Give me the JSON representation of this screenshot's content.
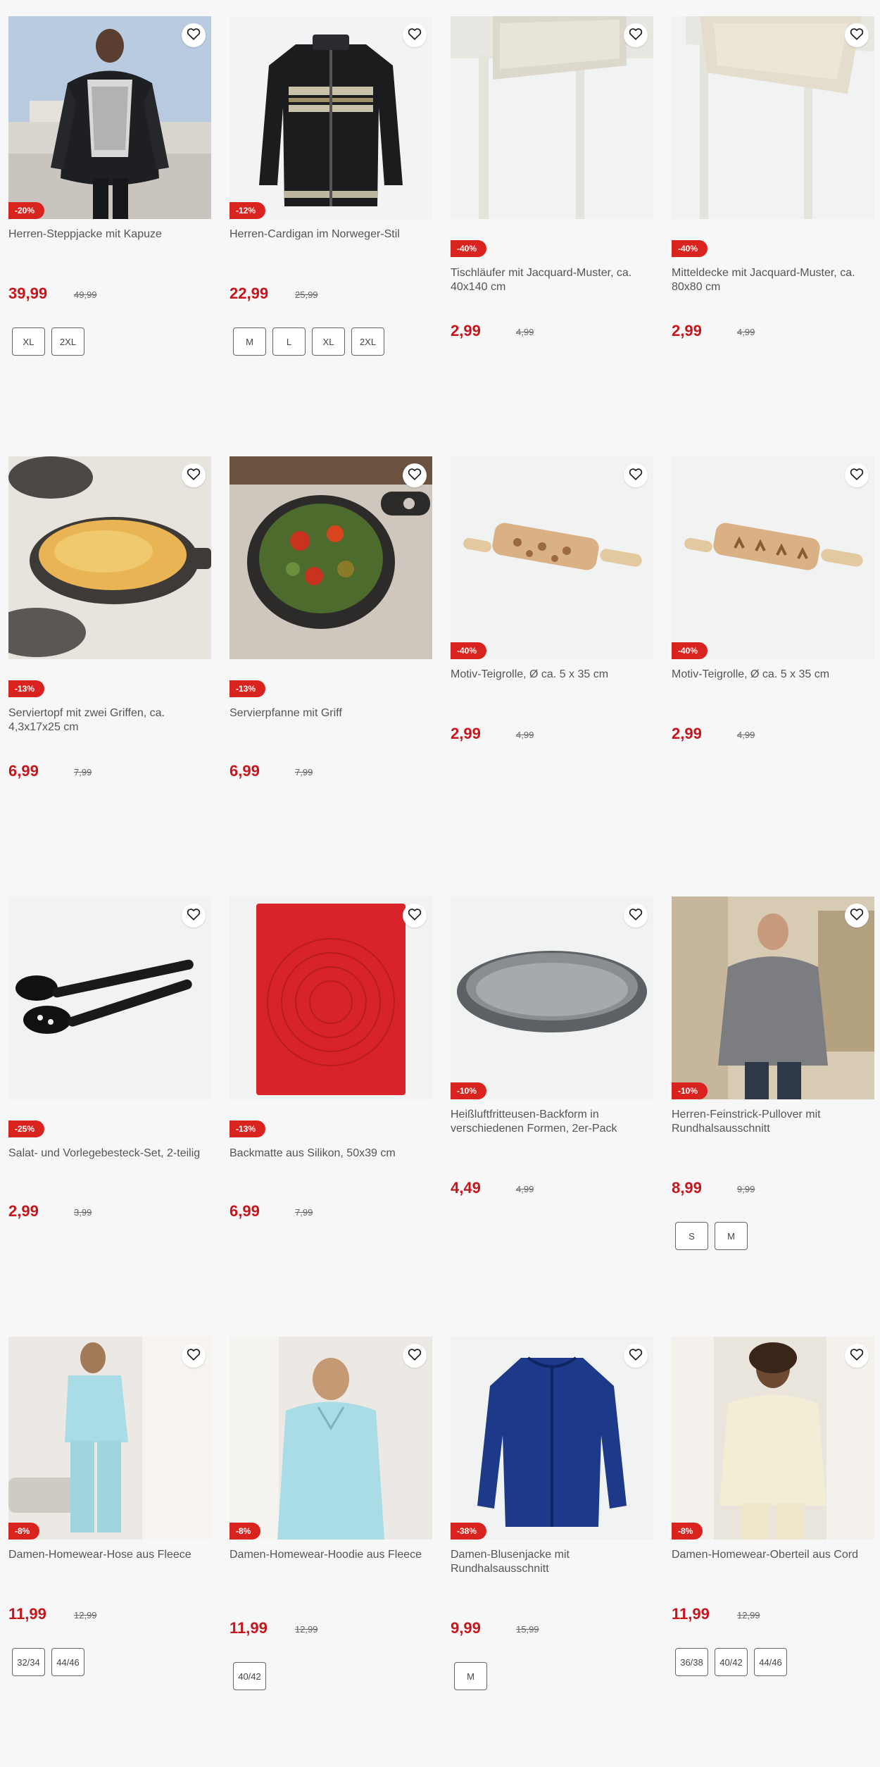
{
  "products": [
    {
      "title": "Herren-Steppjacke mit Kapuze",
      "badge": "-20%",
      "price": "39,99",
      "old_price": "49,99",
      "sizes": [
        "XL",
        "2XL"
      ],
      "image": "puffer-jacket"
    },
    {
      "title": "Herren-Cardigan im Norweger-Stil",
      "badge": "-12%",
      "price": "22,99",
      "old_price": "25,99",
      "sizes": [
        "M",
        "L",
        "XL",
        "2XL"
      ],
      "image": "cardigan"
    },
    {
      "title": "Tischläufer mit Jacquard-Muster, ca. 40x140 cm",
      "badge": "-40%",
      "price": "2,99",
      "old_price": "4,99",
      "sizes": [],
      "image": "table-runner"
    },
    {
      "title": "Mitteldecke mit Jacquard-Muster, ca. 80x80 cm",
      "badge": "-40%",
      "price": "2,99",
      "old_price": "4,99",
      "sizes": [],
      "image": "table-cloth"
    },
    {
      "title": "Serviertopf mit zwei Griffen, ca. 4,3x17x25 cm",
      "badge": "-13%",
      "price": "6,99",
      "old_price": "7,99",
      "sizes": [],
      "image": "serving-pot"
    },
    {
      "title": "Servierpfanne mit Griff",
      "badge": "-13%",
      "price": "6,99",
      "old_price": "7,99",
      "sizes": [],
      "image": "serving-pan"
    },
    {
      "title": "Motiv-Teigrolle, Ø ca. 5 x 35 cm",
      "badge": "-40%",
      "price": "2,99",
      "old_price": "4,99",
      "sizes": [],
      "image": "rolling-pin-stars"
    },
    {
      "title": "Motiv-Teigrolle, Ø ca. 5 x 35 cm",
      "badge": "-40%",
      "price": "2,99",
      "old_price": "4,99",
      "sizes": [],
      "image": "rolling-pin-reindeer"
    },
    {
      "title": "Salat- und Vorlegebesteck-Set, 2-teilig",
      "badge": "-25%",
      "price": "2,99",
      "old_price": "3,99",
      "sizes": [],
      "image": "salad-servers"
    },
    {
      "title": "Backmatte aus Silikon, 50x39 cm",
      "badge": "-13%",
      "price": "6,99",
      "old_price": "7,99",
      "sizes": [],
      "image": "baking-mat"
    },
    {
      "title": "Heißluftfritteusen-Backform in verschiedenen Formen, 2er-Pack",
      "badge": "-10%",
      "price": "4,49",
      "old_price": "4,99",
      "sizes": [],
      "image": "baking-tray"
    },
    {
      "title": "Herren-Feinstrick-Pullover mit Rundhalsausschnitt",
      "badge": "-10%",
      "price": "8,99",
      "old_price": "9,99",
      "sizes": [
        "S",
        "M"
      ],
      "image": "grey-pullover"
    },
    {
      "title": "Damen-Homewear-Hose aus Fleece",
      "badge": "-8%",
      "price": "11,99",
      "old_price": "12,99",
      "sizes": [
        "32/34",
        "44/46"
      ],
      "image": "fleece-pants"
    },
    {
      "title": "Damen-Homewear-Hoodie aus Fleece",
      "badge": "-8%",
      "price": "11,99",
      "old_price": "12,99",
      "sizes": [
        "40/42"
      ],
      "image": "fleece-hoodie"
    },
    {
      "title": "Damen-Blusenjacke mit Rundhalsausschnitt",
      "badge": "-38%",
      "price": "9,99",
      "old_price": "15,99",
      "sizes": [
        "M"
      ],
      "image": "blouse-jacket"
    },
    {
      "title": "Damen-Homewear-Oberteil aus Cord",
      "badge": "-8%",
      "price": "11,99",
      "old_price": "12,99",
      "sizes": [
        "36/38",
        "40/42",
        "44/46"
      ],
      "image": "cord-top"
    }
  ],
  "colors": {
    "price": "#c4161c",
    "badge": "#d8231f"
  },
  "icons": {
    "favorite": "heart-outline-icon"
  }
}
